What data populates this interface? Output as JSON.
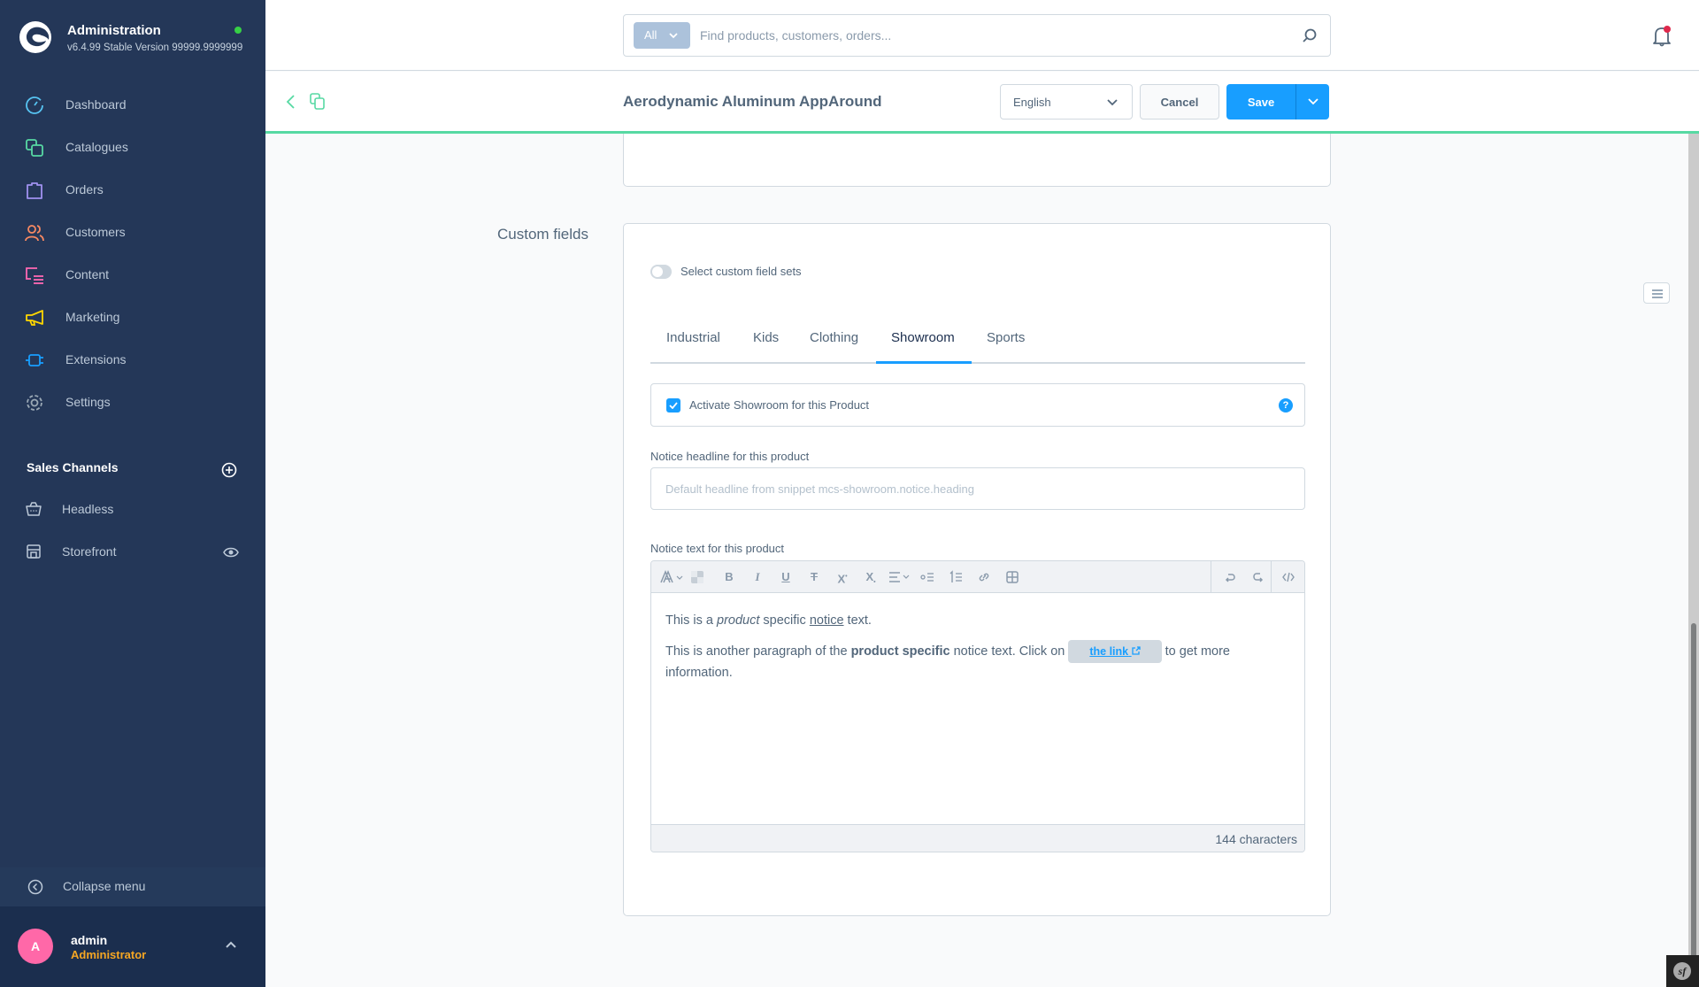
{
  "app": {
    "title": "Administration",
    "version": "v6.4.99 Stable Version 99999.9999999",
    "status_color": "#37d046"
  },
  "sidebar": {
    "items": [
      {
        "label": "Dashboard",
        "icon": "dashboard-icon",
        "color": "#57c4f2"
      },
      {
        "label": "Catalogues",
        "icon": "catalogues-icon",
        "color": "#57d9a3"
      },
      {
        "label": "Orders",
        "icon": "orders-icon",
        "color": "#a092f0"
      },
      {
        "label": "Customers",
        "icon": "customers-icon",
        "color": "#f88962"
      },
      {
        "label": "Content",
        "icon": "content-icon",
        "color": "#ff68b4"
      },
      {
        "label": "Marketing",
        "icon": "marketing-icon",
        "color": "#ffd700"
      },
      {
        "label": "Extensions",
        "icon": "extensions-icon",
        "color": "#189eff"
      },
      {
        "label": "Settings",
        "icon": "settings-icon",
        "color": "#9aa8b5"
      }
    ],
    "sales_channels": {
      "title": "Sales Channels",
      "items": [
        {
          "label": "Headless",
          "icon": "basket-icon"
        },
        {
          "label": "Storefront",
          "icon": "storefront-icon"
        }
      ]
    },
    "collapse_label": "Collapse menu",
    "user": {
      "initial": "A",
      "name": "admin",
      "role": "Administrator"
    }
  },
  "topbar": {
    "search_type": "All",
    "search_placeholder": "Find products, customers, orders...",
    "notification_badge_color": "#de294c"
  },
  "smartbar": {
    "page_title": "Aerodynamic Aluminum AppAround",
    "language": "English",
    "cancel_label": "Cancel",
    "save_label": "Save"
  },
  "custom_fields": {
    "section_label": "Custom fields",
    "toggle_label": "Select custom field sets",
    "toggle_on": false,
    "tabs": [
      "Industrial",
      "Kids",
      "Clothing",
      "Showroom",
      "Sports"
    ],
    "active_tab": "Showroom",
    "activate_label": "Activate Showroom for this Product",
    "activate_checked": true,
    "headline_label": "Notice headline for this product",
    "headline_value": "",
    "headline_placeholder": "Default headline from snippet mcs-showroom.notice.heading",
    "text_label": "Notice text for this product",
    "editor": {
      "p1": {
        "t1": "This is a ",
        "italic": "product",
        "t2": " specific ",
        "underline": "notice",
        "t3": " text."
      },
      "p2": {
        "t1": "This is another paragraph of the ",
        "bold": "product specific",
        "t2": " notice text. Click on ",
        "link": "the link",
        "t3": " to get more information."
      },
      "char_count": "144 characters"
    }
  },
  "colors": {
    "sidebar_bg": "#243758",
    "accent": "#189eff",
    "success": "#57d9a3"
  }
}
